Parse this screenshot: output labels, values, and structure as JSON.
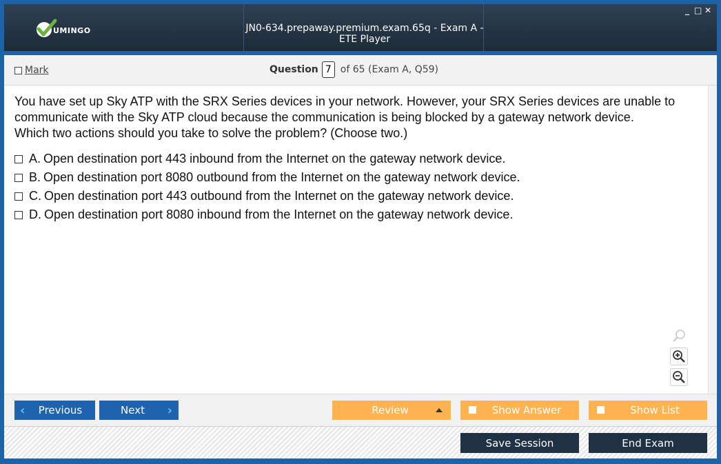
{
  "window": {
    "title": "JN0-634.prepaway.premium.exam.65q - Exam A - ETE Player",
    "logo_text": "UMINGO",
    "controls": [
      "_",
      "□",
      "✕"
    ]
  },
  "question_bar": {
    "mark_label": "Mark",
    "question_label": "Question",
    "question_number": "7",
    "question_suffix": "of 65 (Exam A, Q59)"
  },
  "question": {
    "stem": "You have set up Sky ATP with the SRX Series devices in your network. However, your SRX Series devices are unable to communicate with the Sky ATP cloud because the communication is being blocked by a gateway network device.",
    "ask": "Which two actions should you take to solve the problem? (Choose two.)",
    "options": [
      {
        "letter": "A.",
        "text": "Open destination port 443 inbound from the Internet on the gateway network device."
      },
      {
        "letter": "B.",
        "text": "Open destination port 8080 outbound from the Internet on the gateway network device."
      },
      {
        "letter": "C.",
        "text": "Open destination port 443 outbound from the Internet on the gateway network device."
      },
      {
        "letter": "D.",
        "text": "Open destination port 8080 inbound from the Internet on the gateway network device."
      }
    ]
  },
  "navigation": {
    "previous_label": "Previous",
    "next_label": "Next",
    "review_label": "Review",
    "show_answer_label": "Show Answer",
    "show_list_label": "Show List"
  },
  "footer": {
    "save_session_label": "Save Session",
    "end_exam_label": "End Exam"
  },
  "colors": {
    "accent_blue": "#1f63ae",
    "orange": "#fcb350",
    "dark_button": "#1e3145",
    "chevron": "#5fc1ee",
    "logo_green": "#6ab43e"
  },
  "icons": [
    "check-logo-icon",
    "search-icon",
    "zoom-in-icon",
    "zoom-out-icon",
    "chevron-left-icon",
    "chevron-right-icon",
    "triangle-up-icon"
  ]
}
